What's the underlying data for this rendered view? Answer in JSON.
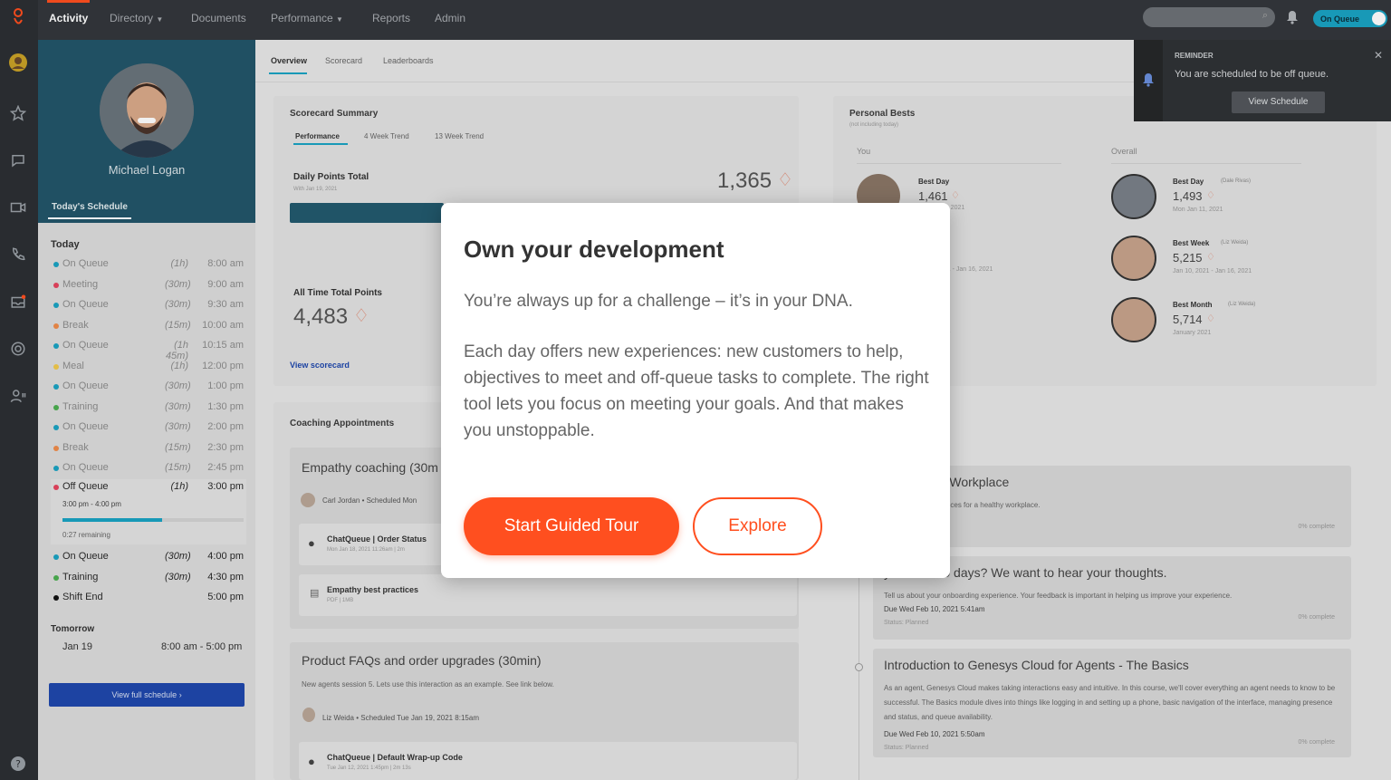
{
  "nav": {
    "items": [
      "Activity",
      "Directory",
      "Documents",
      "Performance",
      "Reports",
      "Admin"
    ],
    "active": "Activity",
    "queue_toggle": "On Queue"
  },
  "profile": {
    "name": "Michael Logan",
    "schedule_tab": "Today's Schedule"
  },
  "schedule": {
    "today_label": "Today",
    "items": [
      {
        "label": "On Queue",
        "dur": "(1h)",
        "time": "8:00 am",
        "color": "#1aa3c3"
      },
      {
        "label": "Meeting",
        "dur": "(30m)",
        "time": "9:00 am",
        "color": "#e6445f"
      },
      {
        "label": "On Queue",
        "dur": "(30m)",
        "time": "9:30 am",
        "color": "#1aa3c3"
      },
      {
        "label": "Break",
        "dur": "(15m)",
        "time": "10:00 am",
        "color": "#f08c4a"
      },
      {
        "label": "On Queue",
        "dur": "(1h 45m)",
        "time": "10:15 am",
        "color": "#1aa3c3"
      },
      {
        "label": "Meal",
        "dur": "(1h)",
        "time": "12:00 pm",
        "color": "#f2c94c"
      },
      {
        "label": "On Queue",
        "dur": "(30m)",
        "time": "1:00 pm",
        "color": "#1aa3c3"
      },
      {
        "label": "Training",
        "dur": "(30m)",
        "time": "1:30 pm",
        "color": "#4caf50"
      },
      {
        "label": "On Queue",
        "dur": "(30m)",
        "time": "2:00 pm",
        "color": "#1aa3c3"
      },
      {
        "label": "Break",
        "dur": "(15m)",
        "time": "2:30 pm",
        "color": "#f08c4a"
      },
      {
        "label": "On Queue",
        "dur": "(15m)",
        "time": "2:45 pm",
        "color": "#1aa3c3"
      }
    ],
    "current": {
      "label": "Off Queue",
      "dur": "(1h)",
      "time": "3:00 pm",
      "range": "3:00 pm - 4:00 pm",
      "remaining": "0:27 remaining",
      "progress": 0.55,
      "color": "#e6445f"
    },
    "later": [
      {
        "label": "On Queue",
        "dur": "(30m)",
        "time": "4:00 pm",
        "color": "#1aa3c3"
      },
      {
        "label": "Training",
        "dur": "(30m)",
        "time": "4:30 pm",
        "color": "#4caf50"
      },
      {
        "label": "Shift End",
        "dur": "",
        "time": "5:00 pm",
        "color": "#111111"
      }
    ],
    "tomorrow_label": "Tomorrow",
    "tomorrow_date": "Jan 19",
    "tomorrow_time": "8:00 am - 5:00 pm",
    "view_full": "View full schedule ›"
  },
  "tabs": [
    "Overview",
    "Scorecard",
    "Leaderboards"
  ],
  "scorecard": {
    "title": "Scorecard Summary",
    "subtabs": [
      "Performance",
      "4 Week Trend",
      "13 Week Trend"
    ],
    "daily_label": "Daily Points Total",
    "daily_sub": "With Jan 19, 2021",
    "daily_value": "1,365",
    "alltime_label": "All Time Total Points",
    "alltime_value": "4,483",
    "view_link": "View scorecard"
  },
  "coaching": {
    "title": "Coaching Appointments",
    "appt1_title": "Empathy coaching (30m",
    "appt1_person": "Carl Jordan • Scheduled Mon",
    "attach1_title": "ChatQueue | Order Status",
    "attach1_sub": "Mon Jan 18, 2021 11:26am | 2m",
    "attach2_title": "Empathy best practices",
    "attach2_sub": "PDF | 1MB",
    "appt2_title": "Product FAQs and order upgrades (30min)",
    "appt2_desc": "New agents session 5. Lets use this interaction as an example. See link below.",
    "appt2_person": "Liz Weida • Scheduled Tue Jan 19, 2021 8:15am",
    "attach3_title": "ChatQueue | Default Wrap-up Code",
    "attach3_sub": "Tue Jan 12, 2021 1:45pm | 2m 13s"
  },
  "bests": {
    "title": "Personal Bests",
    "sub": "(not including today)",
    "you_label": "You",
    "overall_label": "Overall",
    "you": [
      {
        "label": "Best Day",
        "value": "1,461",
        "date": "12, 2021"
      },
      {
        "label": "ek",
        "value": "",
        "date": "021 - Jan 16, 2021"
      },
      {
        "label": "nth",
        "value": "",
        "date": "021"
      }
    ],
    "overall": [
      {
        "label": "Best Day",
        "who": "(Dale Rivas)",
        "value": "1,493",
        "date": "Mon Jan 11, 2021"
      },
      {
        "label": "Best Week",
        "who": "(Liz Weida)",
        "value": "5,215",
        "date": "Jan 10, 2021 - Jan 16, 2021"
      },
      {
        "label": "Best Month",
        "who": "(Liz Weida)",
        "value": "5,714",
        "date": "January 2021"
      }
    ]
  },
  "learning": [
    {
      "title": "afety in the Workplace",
      "desc": "know and best practices for a healthy workplace.",
      "due": "2021 5:40am",
      "status": "",
      "pct": "0% complete"
    },
    {
      "title": "your first 30 days? We want to hear your thoughts.",
      "desc": "Tell us about your onboarding experience. Your feedback is important in helping us improve your experience.",
      "due": "Due Wed Feb 10, 2021 5:41am",
      "status": "Status: Planned",
      "pct": "0% complete"
    },
    {
      "title": "Introduction to Genesys Cloud for Agents - The Basics",
      "desc": "As an agent, Genesys Cloud makes taking interactions easy and intuitive. In this course, we'll cover everything an agent needs to know to be successful. The Basics module dives into things like logging in and setting up a phone, basic navigation of the interface, managing presence and status, and queue availability.",
      "due": "Due Wed Feb 10, 2021 5:50am",
      "status": "Status: Planned",
      "pct": "0% complete"
    }
  ],
  "reminder": {
    "label": "REMINDER",
    "text": "You are scheduled to be off queue.",
    "button": "View Schedule"
  },
  "modal": {
    "title": "Own your development",
    "p1": "You’re always up for a challenge – it’s in your DNA.",
    "p2": "Each day offers new experiences: new customers to help, objectives to meet and off-queue tasks to complete. The right tool lets you focus on meeting your goals. And that makes you unstoppable.",
    "primary": "Start Guided Tour",
    "secondary": "Explore"
  }
}
